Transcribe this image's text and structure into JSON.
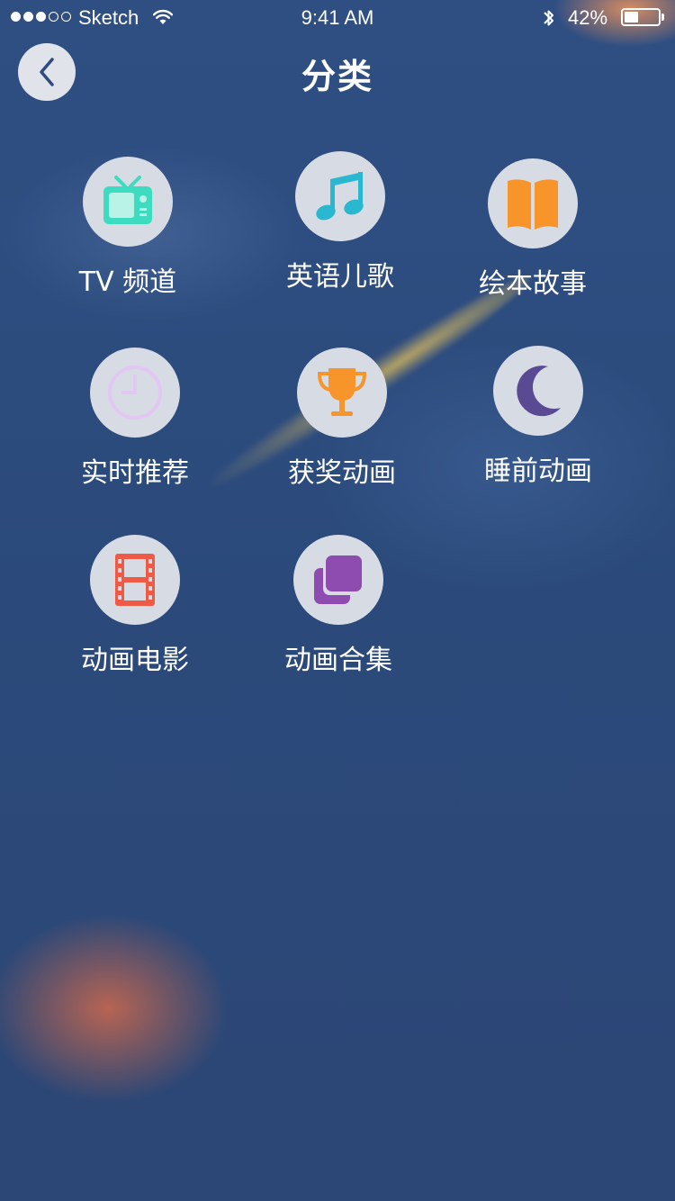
{
  "status_bar": {
    "carrier": "Sketch",
    "time": "9:41 AM",
    "battery_text": "42%",
    "battery_level": 0.42,
    "signal_dots_filled": 3,
    "signal_dots_total": 5
  },
  "nav": {
    "title": "分类"
  },
  "categories": [
    {
      "label": "TV 频道",
      "icon": "tv-icon",
      "color": "#3ddcc0"
    },
    {
      "label": "英语儿歌",
      "icon": "music-note-icon",
      "color": "#29b8d0"
    },
    {
      "label": "绘本故事",
      "icon": "book-icon",
      "color": "#f7952a"
    },
    {
      "label": "实时推荐",
      "icon": "clock-icon",
      "color": "#e2c6f3"
    },
    {
      "label": "获奖动画",
      "icon": "trophy-icon",
      "color": "#f7952a"
    },
    {
      "label": "睡前动画",
      "icon": "moon-icon",
      "color": "#5a4a93"
    },
    {
      "label": "动画电影",
      "icon": "film-icon",
      "color": "#ee5a45"
    },
    {
      "label": "动画合集",
      "icon": "collection-icon",
      "color": "#8e4bb0"
    }
  ]
}
